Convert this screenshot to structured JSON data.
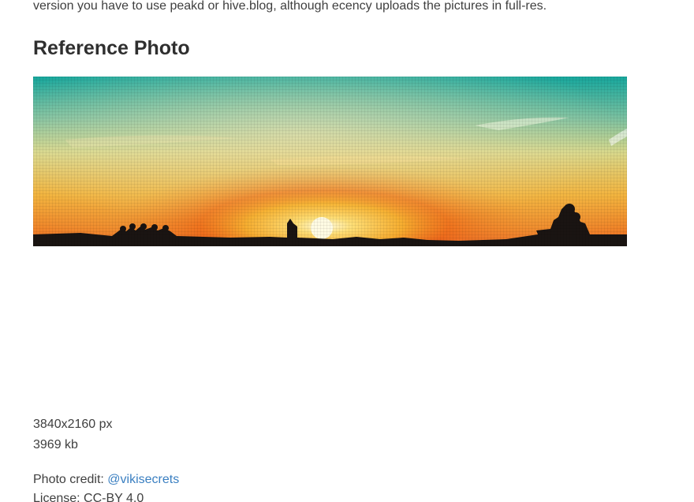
{
  "article": {
    "intro_text": "version you have to use peakd or hive.blog, although ecency uploads the pictures in full-res.",
    "heading": "Reference Photo",
    "photo": {
      "description": "panoramic sunset photograph with sun over city skyline silhouette",
      "colors": {
        "sky_top": "#1fa89e",
        "sky_mid": "#c9d58a",
        "glow": "#f5c742",
        "sun_ring": "#ef6a1c",
        "sun_core": "#fff7c9",
        "silhouette": "#1a1412"
      }
    },
    "resolution": "3840x2160 px",
    "file_size": "3969 kb",
    "credit_label": "Photo credit: ",
    "credit_user": "@vikisecrets",
    "license": "License: CC-BY 4.0"
  }
}
